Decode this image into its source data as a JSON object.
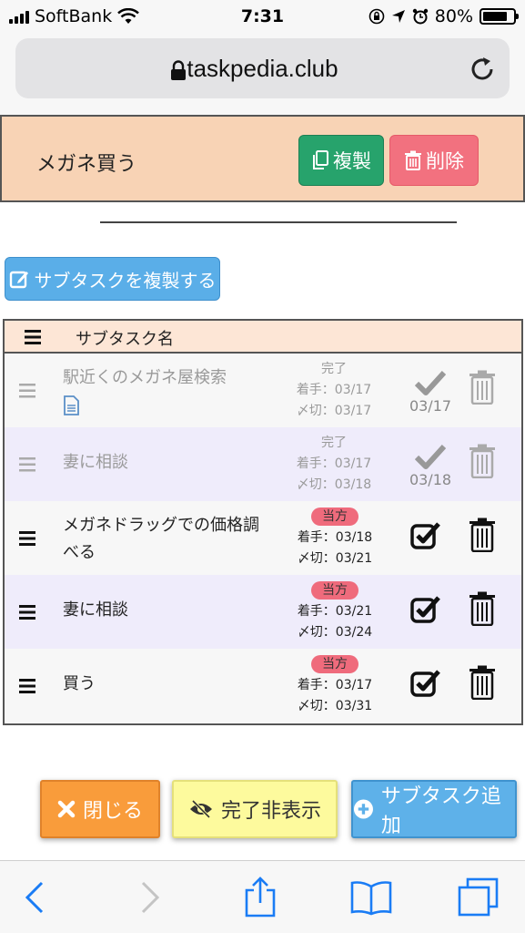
{
  "status_bar": {
    "carrier": "SoftBank",
    "time": "7:31",
    "battery": "80%",
    "battery_level": 0.8
  },
  "browser": {
    "url": "taskpedia.club"
  },
  "task": {
    "title": "メガネ買う",
    "duplicate_label": "複製",
    "delete_label": "削除"
  },
  "subtask_duplicate_label": "サブタスクを複製する",
  "table": {
    "column_header": "サブタスク名",
    "rows": [
      {
        "name": "駅近くのメガネ屋検索",
        "status": "完了",
        "start": "着手：03/17",
        "deadline": "〆切：03/17",
        "completed_date": "03/17",
        "done": true,
        "has_note": true
      },
      {
        "name": "妻に相談",
        "status": "完了",
        "start": "着手：03/17",
        "deadline": "〆切：03/18",
        "completed_date": "03/18",
        "done": true,
        "has_note": false
      },
      {
        "name": "メガネドラッグでの価格調べる",
        "status": "当方",
        "start": "着手：03/18",
        "deadline": "〆切：03/21",
        "done": false
      },
      {
        "name": "妻に相談",
        "status": "当方",
        "start": "着手：03/21",
        "deadline": "〆切：03/24",
        "done": false
      },
      {
        "name": "買う",
        "status": "当方",
        "start": "着手：03/17",
        "deadline": "〆切：03/31",
        "done": false
      }
    ]
  },
  "actions": {
    "close": "閉じる",
    "hide_done": "完了非表示",
    "add_subtask": "サブタスク追加"
  },
  "colors": {
    "header_bg": "#f8d3b5",
    "duplicate_green": "#27a36c",
    "delete_red": "#f2717f",
    "blue": "#5aaee8",
    "orange": "#f99c3b",
    "yellow": "#fdfa9d",
    "badge": "#ef6b7c",
    "row_alt": "#efecfb"
  },
  "icons": {
    "signal": "signal-bars-icon",
    "wifi": "wifi-icon",
    "lock": "lock-icon",
    "reload": "reload-icon",
    "back": "chevron-left-icon",
    "forward": "chevron-right-icon",
    "share": "share-icon",
    "bookmarks": "book-icon",
    "tabs": "tabs-icon"
  }
}
